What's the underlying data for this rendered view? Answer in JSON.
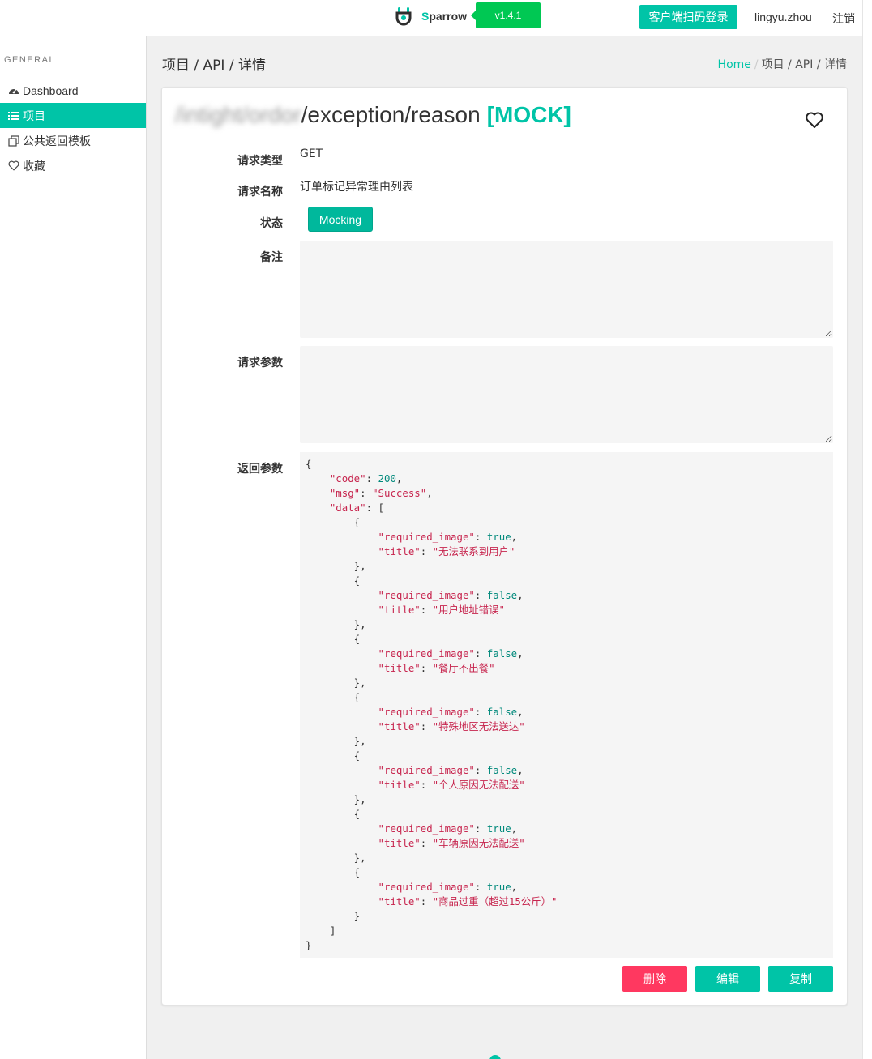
{
  "navbar": {
    "brand_s": "S",
    "brand_rest": "parrow",
    "version": "v1.4.1",
    "scan_login": "客户端扫码登录",
    "username": "lingyu.zhou",
    "logout": "注销",
    "accent_color": "#00c4a7"
  },
  "sidebar": {
    "section_label": "GENERAL",
    "items": [
      {
        "label": "Dashboard",
        "icon": "dashboard-icon",
        "active": false
      },
      {
        "label": "项目",
        "icon": "list-icon",
        "active": true
      },
      {
        "label": "公共返回模板",
        "icon": "copy-icon",
        "active": false
      },
      {
        "label": "收藏",
        "icon": "heart-icon",
        "active": false
      }
    ]
  },
  "header": {
    "title": "项目 / API / 详情",
    "breadcrumb_home": "Home",
    "breadcrumb_sep": "/",
    "breadcrumb_current": "项目 / API / 详情"
  },
  "api": {
    "path_prefix_blurred": "/intight/ordor",
    "path": "/exception/reason",
    "mock_tag": "[MOCK]",
    "fields": {
      "method_label": "请求类型",
      "method": "GET",
      "name_label": "请求名称",
      "name": "订单标记异常理由列表",
      "status_label": "状态",
      "status": "Mocking",
      "remark_label": "备注",
      "remark": "",
      "params_label": "请求参数",
      "params": "",
      "response_label": "返回参数"
    },
    "response": {
      "code": 200,
      "msg": "Success",
      "data": [
        {
          "required_image": true,
          "title": "无法联系到用户"
        },
        {
          "required_image": false,
          "title": "用户地址错误"
        },
        {
          "required_image": false,
          "title": "餐厅不出餐"
        },
        {
          "required_image": false,
          "title": "特殊地区无法送达"
        },
        {
          "required_image": false,
          "title": "个人原因无法配送"
        },
        {
          "required_image": true,
          "title": "车辆原因无法配送"
        },
        {
          "required_image": true,
          "title": "商品过重（超过15公斤）"
        }
      ]
    }
  },
  "actions": {
    "delete": "删除",
    "edit": "编辑",
    "copy": "复制",
    "delete_color": "#ff3860"
  }
}
